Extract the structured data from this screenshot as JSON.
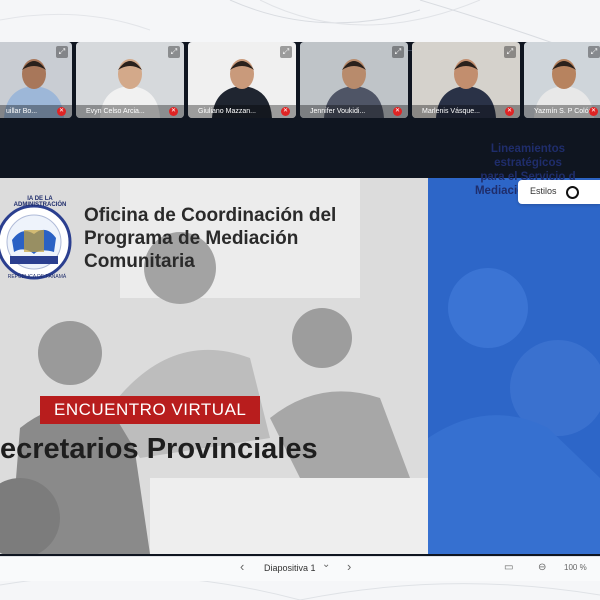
{
  "participants": [
    {
      "name": "uillar Bo...",
      "bg": "#c9cdd3",
      "skin": "#a8775a",
      "shirt": "#9db7d8"
    },
    {
      "name": "Evyn Celso Arcia...",
      "bg": "#d6d9dc",
      "skin": "#d3a98a",
      "shirt": "#f1f1f1"
    },
    {
      "name": "Giuliano Mazzan...",
      "bg": "#f0f0f0",
      "skin": "#c99a7b",
      "shirt": "#1f2530"
    },
    {
      "name": "Jennifer Voukidi...",
      "bg": "#bfc4c8",
      "skin": "#b88b6c",
      "shirt": "#4f5566"
    },
    {
      "name": "Marlenis Vásque...",
      "bg": "#d5d2cc",
      "skin": "#c28e6e",
      "shirt": "#2a3247"
    },
    {
      "name": "Yazmín S. P Colón",
      "bg": "#cfd5da",
      "skin": "#b7835f",
      "shirt": "#e8e8e8"
    }
  ],
  "tile_expand_glyph": "⤢",
  "tile_mic_glyph": "✕",
  "slide": {
    "logo_text": "IA DE LA ADMINISTRACIÓN",
    "logo_bottom_text": "REPÚBLICA DE PANAMÁ",
    "title_lines": [
      "Oficina de Coordinación del",
      "Programa de Mediación",
      "Comunitaria"
    ],
    "badge": "ENCUENTRO VIRTUAL",
    "subtitle": "ecretarios Provinciales",
    "side_text_lines": [
      "Lineamientos",
      "estratégicos",
      "para el Servicio d",
      "Mediación Comunit"
    ],
    "accent_red": "#b81d1d",
    "accent_blue": "#2d66c8"
  },
  "styles_panel": {
    "label": "Estilos"
  },
  "toolbar": {
    "prev": "‹",
    "slide_label": "Diapositiva 1",
    "dropdown": "⌄",
    "next": "›",
    "zoom": "100 %",
    "zoom_minus": "⊖",
    "view_icon": "▭"
  }
}
